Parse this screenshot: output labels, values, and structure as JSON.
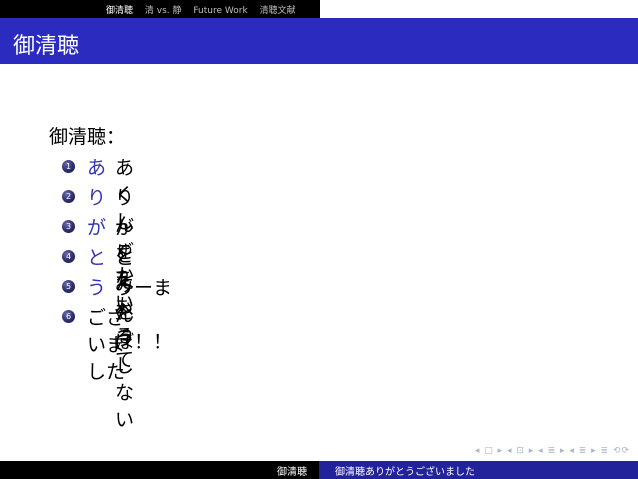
{
  "nav": {
    "sections": [
      "御清聴",
      "清 vs. 静",
      "Future Work",
      "清聴文献"
    ]
  },
  "frame_title": "御清聴",
  "heading": "御清聴：",
  "items": [
    {
      "number": "1",
      "kana": "あ",
      "text": "あくしゅかい"
    },
    {
      "number": "2",
      "kana": "り",
      "text": "りんごをもって"
    },
    {
      "number": "3",
      "kana": "が",
      "text": "がをたべる"
    },
    {
      "number": "4",
      "kana": "と",
      "text": "とみをうしない"
    },
    {
      "number": "5",
      "kana": "う",
      "text": "うーまんぼ！！"
    },
    {
      "number": "6",
      "kana": "",
      "text": "ございました"
    }
  ],
  "nav_symbols": "◂ □ ▸ ◂ ⊡ ▸ ◂ ≣ ▸ ◂ ≣ ▸ ≣ ⟲⟳",
  "footer": {
    "author": "御清聴",
    "title": "御清聴ありがとうございました"
  },
  "colors": {
    "title_bar": "#2b2bbf",
    "kana": "#3333b3",
    "footer_right": "#22229a"
  }
}
